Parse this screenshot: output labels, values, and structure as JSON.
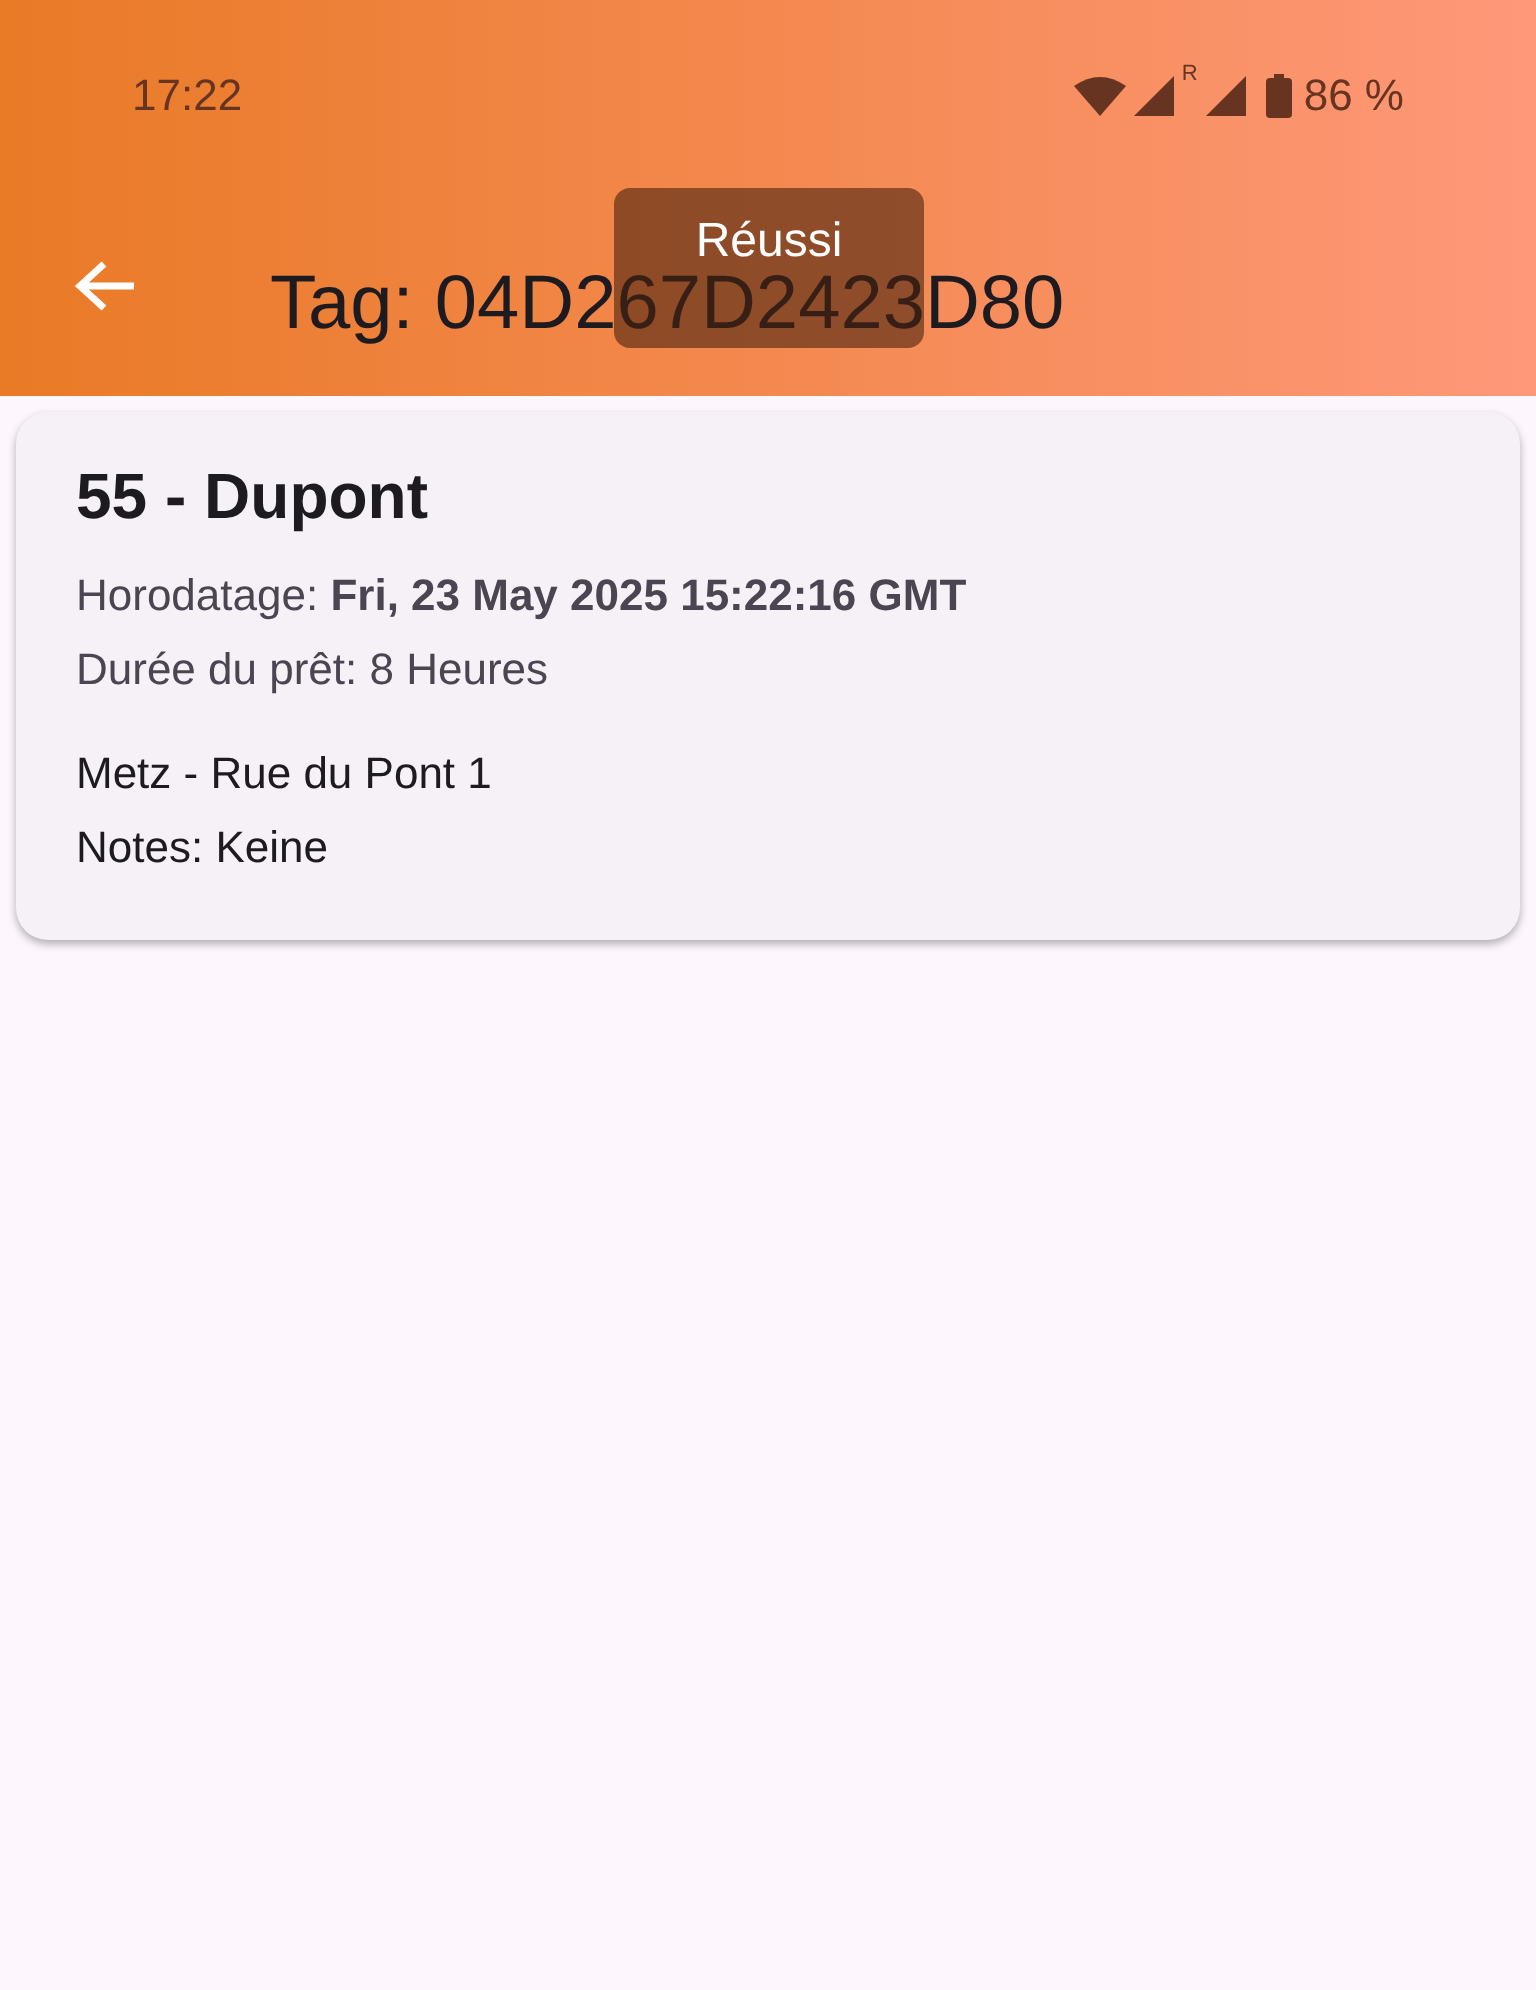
{
  "status_bar": {
    "time": "17:22",
    "roaming_mark": "R",
    "battery": "86 %"
  },
  "app_bar": {
    "title": "Tag: 04D267D2423D80"
  },
  "toast": {
    "text": "Réussi"
  },
  "card": {
    "title": "55 - Dupont",
    "timestamp": "Horodatage: **Fri, 23 May 2025 15:22:16 GMT**",
    "duration": "Durée du prêt: 8 Heures",
    "address": "Metz - Rue du Pont 1",
    "notes": "Notes: Keine"
  }
}
